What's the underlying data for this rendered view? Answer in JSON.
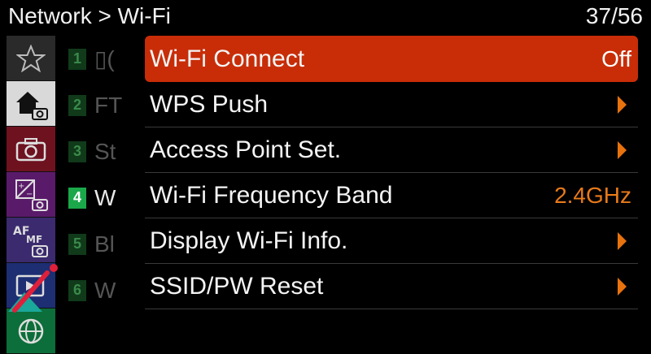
{
  "header": {
    "breadcrumb": "Network > Wi-Fi",
    "page": "37/56"
  },
  "tabs": [
    {
      "icon": "star-icon"
    },
    {
      "icon": "home-camera-icon"
    },
    {
      "icon": "camera-icon"
    },
    {
      "icon": "exposure-camera-icon"
    },
    {
      "icon": "af-mf-camera-icon"
    },
    {
      "icon": "playback-icon"
    },
    {
      "icon": "network-globe-icon"
    }
  ],
  "subpages": [
    {
      "num": "1",
      "text": "▯("
    },
    {
      "num": "2",
      "text": "FT"
    },
    {
      "num": "3",
      "text": "St"
    },
    {
      "num": "4",
      "text": "W"
    },
    {
      "num": "5",
      "text": "Bl"
    },
    {
      "num": "6",
      "text": "W"
    }
  ],
  "menu": [
    {
      "label": "Wi-Fi Connect",
      "value": "Off"
    },
    {
      "label": "WPS Push",
      "value": ""
    },
    {
      "label": "Access Point Set.",
      "value": ""
    },
    {
      "label": "Wi-Fi Frequency Band",
      "value": "2.4GHz"
    },
    {
      "label": "Display Wi-Fi Info.",
      "value": ""
    },
    {
      "label": "SSID/PW Reset",
      "value": ""
    }
  ],
  "colors": {
    "selected": "#c82d08",
    "value_orange": "#e87a1a",
    "active_sub": "#1aa84a"
  }
}
